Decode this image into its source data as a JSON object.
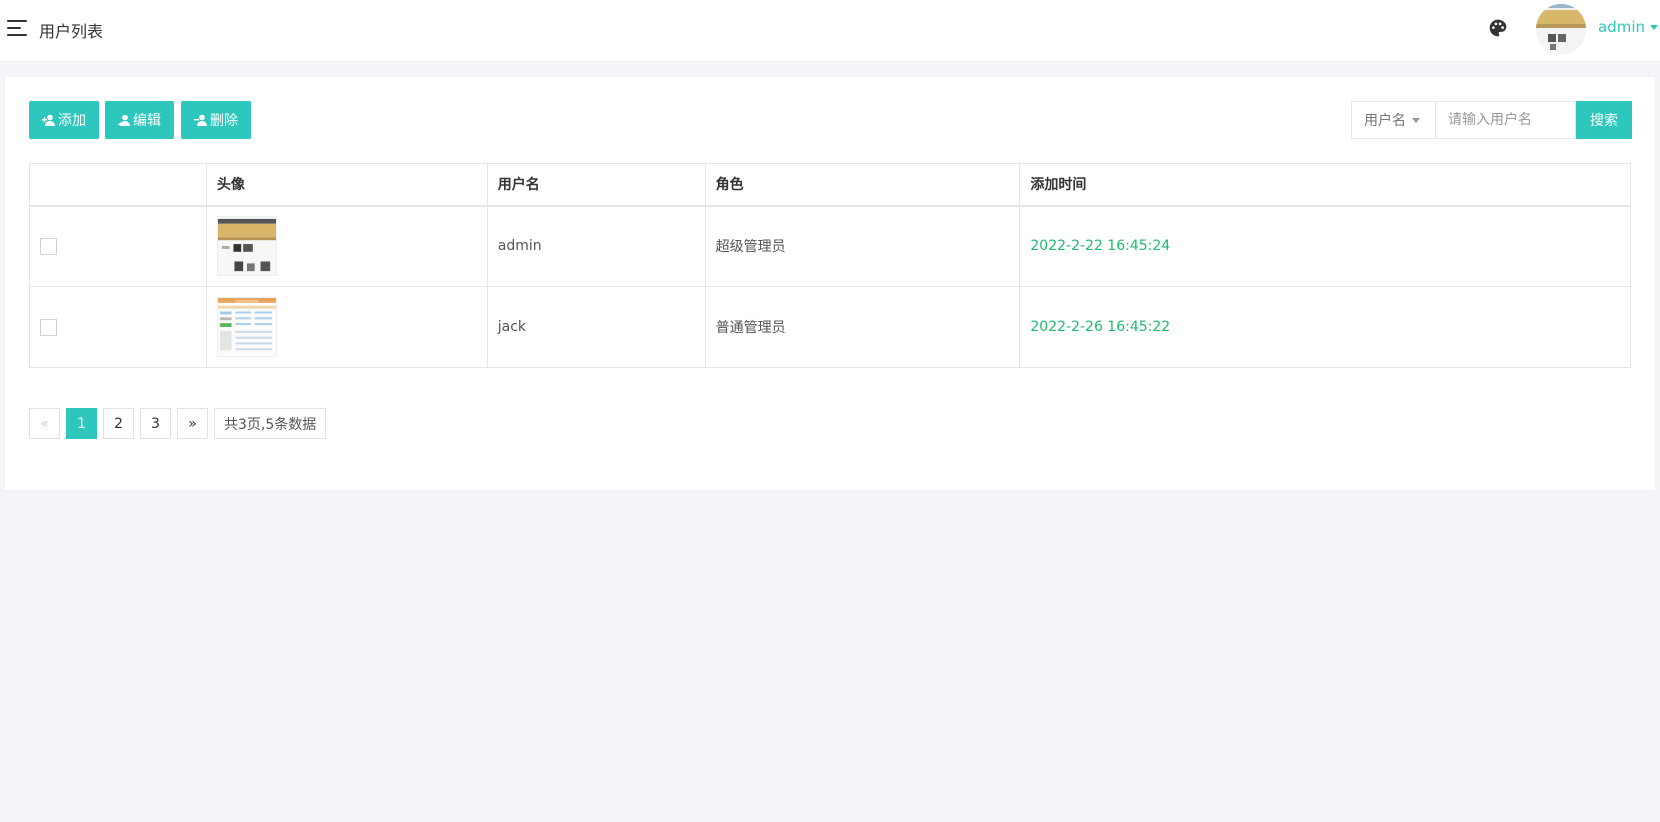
{
  "header": {
    "title": "用户列表",
    "menu_icon": "hamburger-menu-icon",
    "theme_icon": "palette-icon",
    "user_name": "admin"
  },
  "toolbar": {
    "add_label": "添加",
    "edit_label": "编辑",
    "delete_label": "删除"
  },
  "search": {
    "field_label": "用户名",
    "placeholder": "请输入用户名",
    "value": "",
    "button_label": "搜索"
  },
  "table": {
    "columns": [
      "",
      "头像",
      "用户名",
      "角色",
      "添加时间"
    ],
    "rows": [
      {
        "checked": false,
        "username": "admin",
        "role": "超级管理员",
        "added_time": "2022-2-22 16:45:24"
      },
      {
        "checked": false,
        "username": "jack",
        "role": "普通管理员",
        "added_time": "2022-2-26 16:45:22"
      }
    ]
  },
  "pagination": {
    "prev": "«",
    "pages": [
      "1",
      "2",
      "3"
    ],
    "current": "1",
    "next": "»",
    "info": "共3页,5条数据"
  },
  "colors": {
    "accent": "#2ec7bd",
    "time_text": "#1fba6e",
    "background": "#f4f5f9"
  }
}
